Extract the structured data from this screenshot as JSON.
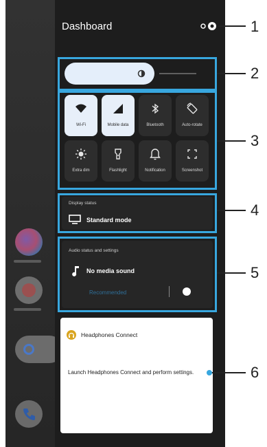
{
  "dashboard": {
    "title": "Dashboard"
  },
  "brightness": {
    "level": 0.67
  },
  "quick_settings": {
    "tiles": [
      {
        "label": "Wi-Fi",
        "icon": "wifi-icon",
        "active": true
      },
      {
        "label": "Mobile data",
        "icon": "mobile-data-icon",
        "active": true
      },
      {
        "label": "Bluetooth",
        "icon": "bluetooth-icon",
        "active": false
      },
      {
        "label": "Auto-rotate",
        "icon": "auto-rotate-icon",
        "active": false
      },
      {
        "label": "Extra dim",
        "icon": "extra-dim-icon",
        "active": false
      },
      {
        "label": "Flashlight",
        "icon": "flashlight-icon",
        "active": false
      },
      {
        "label": "Notification",
        "icon": "notification-icon",
        "active": false
      },
      {
        "label": "Screenshot",
        "icon": "screenshot-icon",
        "active": false
      }
    ]
  },
  "display_status": {
    "caption": "Display status",
    "value": "Standard mode",
    "icon": "display-icon"
  },
  "audio": {
    "caption": "Audio status and settings",
    "value": "No media sound",
    "icon": "music-note-icon",
    "link": "Recommended"
  },
  "headphones_connect": {
    "title": "Headphones Connect",
    "description": "Launch Headphones Connect and perform settings.",
    "icon": "headphones-connect-logo"
  },
  "callouts": [
    "1",
    "2",
    "3",
    "4",
    "5",
    "6"
  ],
  "colors": {
    "accent": "#38a7df",
    "panel": "#1d1d1d",
    "tile_on": "#e7eff9"
  }
}
